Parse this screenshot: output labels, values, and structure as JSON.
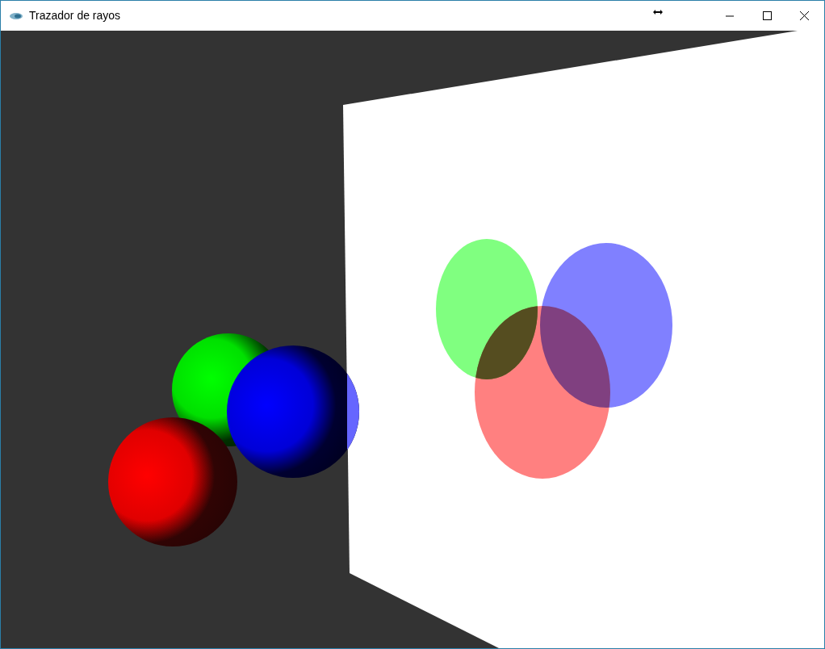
{
  "window": {
    "title": "Trazador de rayos"
  }
}
